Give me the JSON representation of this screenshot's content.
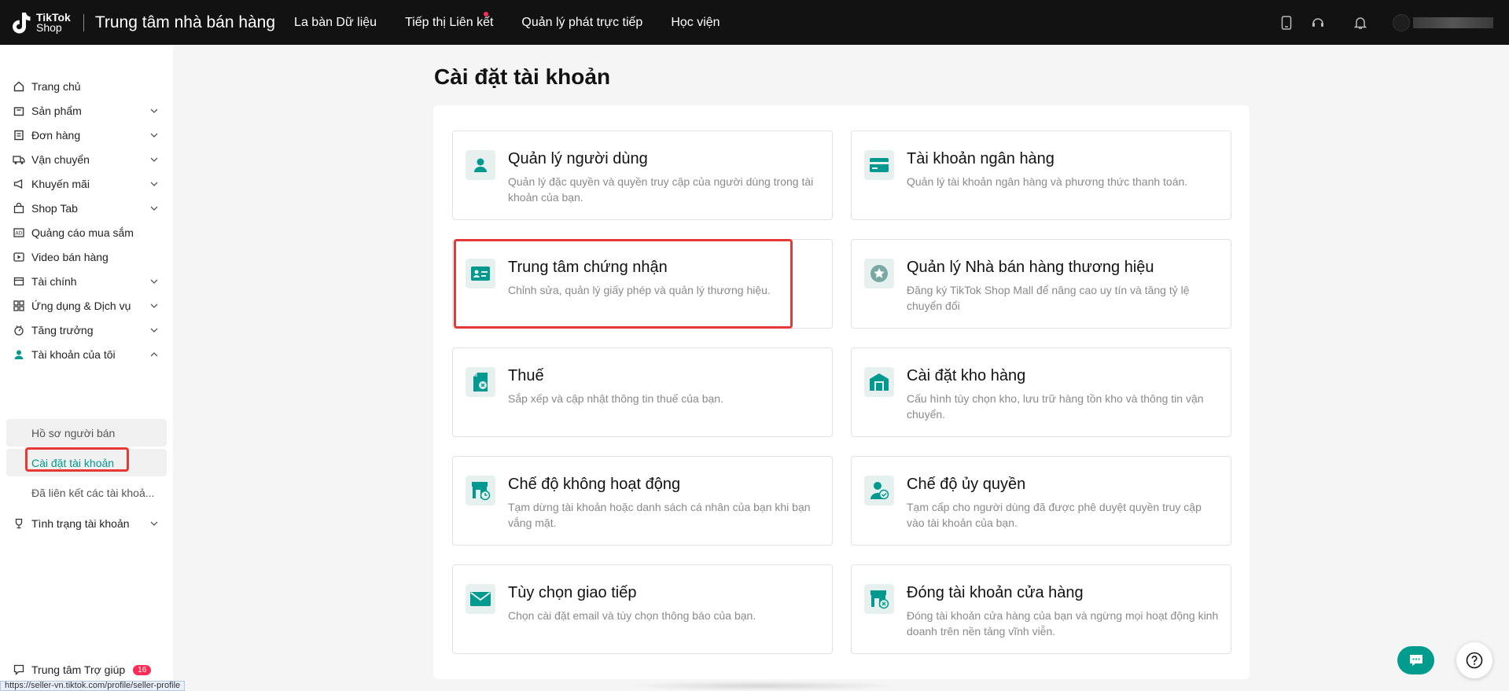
{
  "header": {
    "logo_line1": "TikTok",
    "logo_line2": "Shop",
    "app_title": "Trung tâm nhà bán hàng",
    "nav": [
      {
        "label": "La bàn Dữ liệu"
      },
      {
        "label": "Tiếp thị Liên kết"
      },
      {
        "label": "Quản lý phát trực tiếp"
      },
      {
        "label": "Học viện"
      }
    ],
    "icons": [
      "phone-icon",
      "headset-icon",
      "bell-icon"
    ]
  },
  "sidebar": {
    "items": [
      {
        "label": "Trang chủ",
        "icon": "home-icon"
      },
      {
        "label": "Sản phẩm",
        "icon": "product-icon"
      },
      {
        "label": "Đơn hàng",
        "icon": "order-icon"
      },
      {
        "label": "Vận chuyển",
        "icon": "truck-icon"
      },
      {
        "label": "Khuyến mãi",
        "icon": "megaphone-icon"
      },
      {
        "label": "Shop Tab",
        "icon": "shop-bag-icon"
      },
      {
        "label": "Quảng cáo mua sắm",
        "icon": "ad-icon"
      },
      {
        "label": "Video bán hàng",
        "icon": "video-icon"
      },
      {
        "label": "Tài chính",
        "icon": "wallet-icon"
      },
      {
        "label": "Ứng dụng & Dịch vụ",
        "icon": "apps-icon"
      },
      {
        "label": "Tăng trưởng",
        "icon": "growth-icon"
      },
      {
        "label": "Tài khoản của tôi",
        "icon": "user-icon"
      }
    ],
    "account_sub": [
      {
        "label": "Hồ sơ người bán"
      },
      {
        "label": "Cài đặt tài khoản"
      },
      {
        "label": "Đã liên kết các tài khoả..."
      }
    ],
    "status_item": {
      "label": "Tình trạng tài khoản",
      "icon": "trophy-icon"
    },
    "help": {
      "label": "Trung tâm Trợ giúp",
      "badge": "16"
    }
  },
  "status_url": "https://seller-vn.tiktok.com/profile/seller-profile",
  "main": {
    "title": "Cài đặt tài khoản",
    "cards": [
      {
        "title": "Quản lý người dùng",
        "desc": "Quản lý đặc quyền và quyền truy cập của người dùng trong tài khoản của bạn.",
        "icon": "user-management-icon"
      },
      {
        "title": "Tài khoản ngân hàng",
        "desc": "Quản lý tài khoản ngân hàng và phương thức thanh toán.",
        "icon": "bank-card-icon"
      },
      {
        "title": "Trung tâm chứng nhận",
        "desc": "Chỉnh sửa, quản lý giấy phép và quản lý thương hiệu.",
        "icon": "id-card-icon"
      },
      {
        "title": "Quản lý Nhà bán hàng thương hiệu",
        "desc": "Đăng ký TikTok Shop Mall để nâng cao uy tín và tăng tỷ lệ chuyển đổi",
        "icon": "brand-star-icon"
      },
      {
        "title": "Thuế",
        "desc": "Sắp xếp và cập nhật thông tin thuế của bạn.",
        "icon": "tax-document-icon"
      },
      {
        "title": "Cài đặt kho hàng",
        "desc": "Cấu hình tùy chọn kho, lưu trữ hàng tồn kho và thông tin vận chuyển.",
        "icon": "warehouse-icon"
      },
      {
        "title": "Chế độ không hoạt động",
        "desc": "Tạm dừng tài khoản hoặc danh sách cá nhân của bạn khi bạn vắng mặt.",
        "icon": "store-clock-icon"
      },
      {
        "title": "Chế độ ủy quyền",
        "desc": "Tạm cấp cho người dùng đã được phê duyệt quyền truy cập vào tài khoản của bạn.",
        "icon": "user-check-icon"
      },
      {
        "title": "Tùy chọn giao tiếp",
        "desc": "Chọn cài đặt email và tùy chọn thông báo của bạn.",
        "icon": "mail-icon"
      },
      {
        "title": "Đóng tài khoản cửa hàng",
        "desc": "Đóng tài khoản cửa hàng của bạn và ngừng mọi hoạt động kinh doanh trên nền tảng vĩnh viễn.",
        "icon": "store-close-icon"
      }
    ]
  },
  "colors": {
    "accent": "#009c8e",
    "topbar": "#121212",
    "highlight": "#e53935"
  }
}
